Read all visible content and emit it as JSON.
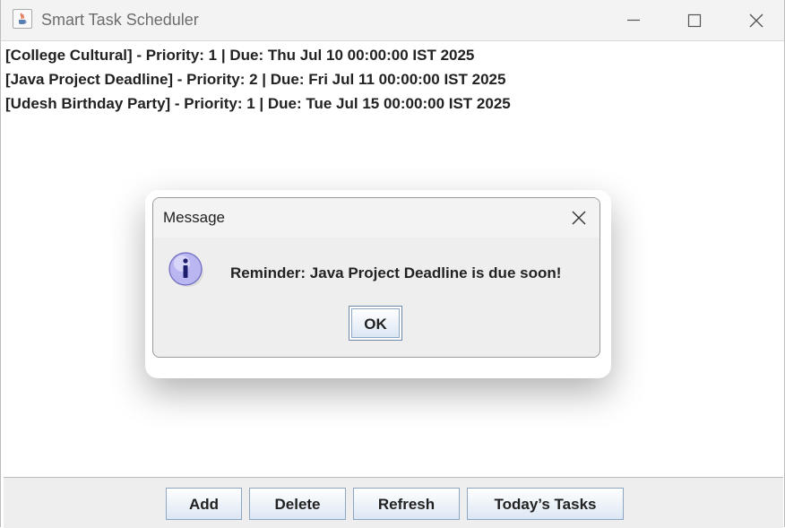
{
  "window": {
    "title": "Smart Task Scheduler",
    "app_icon": "java-cup-icon",
    "controls": [
      "minimize-icon",
      "maximize-icon",
      "close-icon"
    ]
  },
  "tasks": [
    "[College Cultural] - Priority: 1 | Due: Thu Jul 10 00:00:00 IST 2025",
    "[Java Project Deadline] - Priority: 2 | Due: Fri Jul 11 00:00:00 IST 2025",
    "[Udesh Birthday Party] - Priority: 1 | Due: Tue Jul 15 00:00:00 IST 2025"
  ],
  "buttons": {
    "add": "Add",
    "delete": "Delete",
    "refresh": "Refresh",
    "todays_tasks": "Today’s Tasks"
  },
  "dialog": {
    "title": "Message",
    "message": "Reminder: Java Project Deadline is due soon!",
    "ok_label": "OK",
    "icon": "info-icon"
  },
  "colors": {
    "button_border": "#8da6c4",
    "button_gradient_bottom": "#dce7f4",
    "info_icon": "#b9b6f2"
  }
}
